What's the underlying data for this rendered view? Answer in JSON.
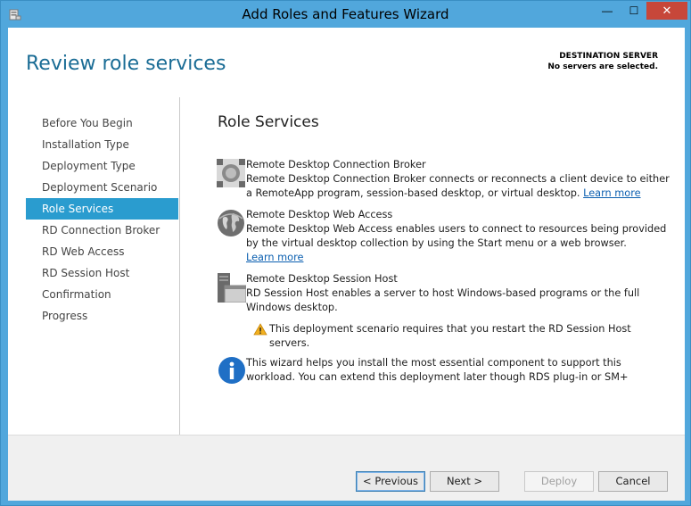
{
  "window": {
    "title": "Add Roles and Features Wizard",
    "minimize": "—",
    "maximize": "☐",
    "close": "✕"
  },
  "header": {
    "page_title": "Review role services",
    "dest_label": "DESTINATION SERVER",
    "dest_value": "No servers are selected."
  },
  "sidebar": {
    "items": [
      {
        "label": "Before You Begin"
      },
      {
        "label": "Installation Type"
      },
      {
        "label": "Deployment Type"
      },
      {
        "label": "Deployment Scenario"
      },
      {
        "label": "Role Services",
        "active": true
      },
      {
        "label": "RD Connection Broker"
      },
      {
        "label": "RD Web Access"
      },
      {
        "label": "RD Session Host"
      },
      {
        "label": "Confirmation"
      },
      {
        "label": "Progress"
      }
    ]
  },
  "main": {
    "section_title": "Role Services",
    "services": [
      {
        "name": "Remote Desktop Connection Broker",
        "desc": "Remote Desktop Connection Broker connects or reconnects a client device to either a RemoteApp program, session-based desktop, or virtual desktop.",
        "link": "Learn more",
        "icon": "connection-broker-icon"
      },
      {
        "name": "Remote Desktop Web Access",
        "desc": "Remote Desktop Web Access enables users to connect to resources being provided by the virtual desktop collection by using the Start menu or a web browser.",
        "link": "Learn more",
        "icon": "web-access-globe-icon"
      },
      {
        "name": "Remote Desktop Session Host",
        "desc": "RD Session Host enables a server to host Windows-based programs or the full Windows desktop.",
        "icon": "session-host-server-icon"
      }
    ],
    "warning": "This deployment scenario requires that you restart the RD Session Host servers.",
    "info": "This wizard helps you install the most essential component to support this workload. You can extend this deployment later though RDS plug-in or SM+"
  },
  "footer": {
    "previous": "< Previous",
    "next": "Next >",
    "deploy": "Deploy",
    "cancel": "Cancel"
  },
  "colors": {
    "frame": "#51a7dc",
    "accent": "#2a9ccf",
    "title_text": "#1a6c95",
    "close_button": "#c7473a"
  }
}
